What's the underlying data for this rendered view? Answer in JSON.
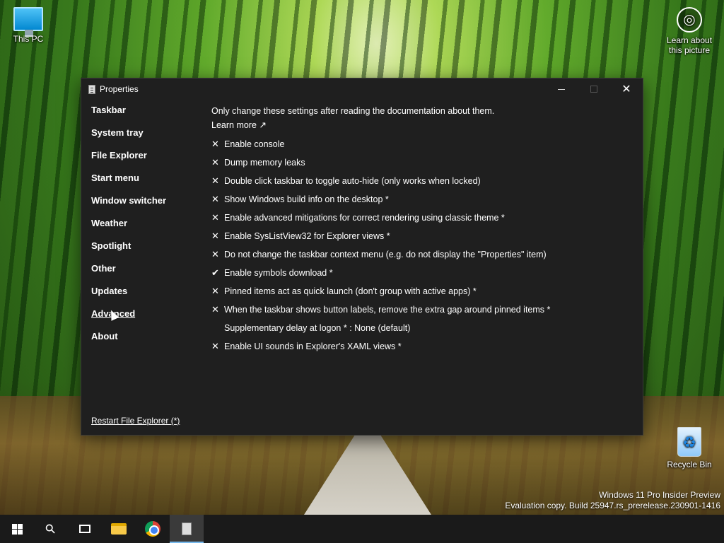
{
  "desktop": {
    "icons": [
      {
        "label": "This PC",
        "icon": "monitor-icon"
      },
      {
        "label": "Recycle Bin",
        "icon": "recycle-bin-icon"
      },
      {
        "label": "Learn about\nthis picture",
        "icon": "camera-icon"
      }
    ],
    "watermark": {
      "line1": "Windows 11 Pro Insider Preview",
      "line2": "Evaluation copy. Build 25947.rs_prerelease.230901-1416"
    }
  },
  "window": {
    "title": "Properties",
    "controls": {
      "minimize": "minimize",
      "maximize": "maximize",
      "close": "✕"
    },
    "sidebar": {
      "items": [
        {
          "label": "Taskbar"
        },
        {
          "label": "System tray"
        },
        {
          "label": "File Explorer"
        },
        {
          "label": "Start menu"
        },
        {
          "label": "Window switcher"
        },
        {
          "label": "Weather"
        },
        {
          "label": "Spotlight"
        },
        {
          "label": "Other"
        },
        {
          "label": "Updates"
        },
        {
          "label": "Advanced"
        },
        {
          "label": "About"
        }
      ],
      "active": "Advanced",
      "restart_label": "Restart File Explorer (*)"
    },
    "content": {
      "intro": "Only change these settings after reading the documentation about them.",
      "learn_more": "Learn more ↗",
      "options": [
        {
          "mark": "✕",
          "label": "Enable console"
        },
        {
          "mark": "✕",
          "label": "Dump memory leaks"
        },
        {
          "mark": "✕",
          "label": "Double click taskbar to toggle auto-hide (only works when locked)"
        },
        {
          "mark": "✕",
          "label": "Show Windows build info on the desktop *"
        },
        {
          "mark": "✕",
          "label": "Enable advanced mitigations for correct rendering using classic theme *"
        },
        {
          "mark": "✕",
          "label": "Enable SysListView32 for Explorer views *"
        },
        {
          "mark": "✕",
          "label": "Do not change the taskbar context menu (e.g. do not display the \"Properties\" item)"
        },
        {
          "mark": "✔",
          "label": "Enable symbols download *"
        },
        {
          "mark": "✕",
          "label": "Pinned items act as quick launch (don't group with active apps) *"
        },
        {
          "mark": "✕",
          "label": "When the taskbar shows button labels, remove the extra gap around pinned items *"
        },
        {
          "mark": "",
          "label": "Supplementary delay at logon * : None (default)"
        },
        {
          "mark": "✕",
          "label": "Enable UI sounds in Explorer's XAML views *"
        }
      ]
    }
  },
  "taskbar": {
    "buttons": [
      "start",
      "search",
      "task-view",
      "file-explorer",
      "chrome",
      "properties"
    ],
    "search_glyph": "⚲"
  },
  "colors": {
    "window_bg": "#1f1f1f",
    "taskbar_bg": "#1a1a1a",
    "accent": "#76b9ed"
  }
}
